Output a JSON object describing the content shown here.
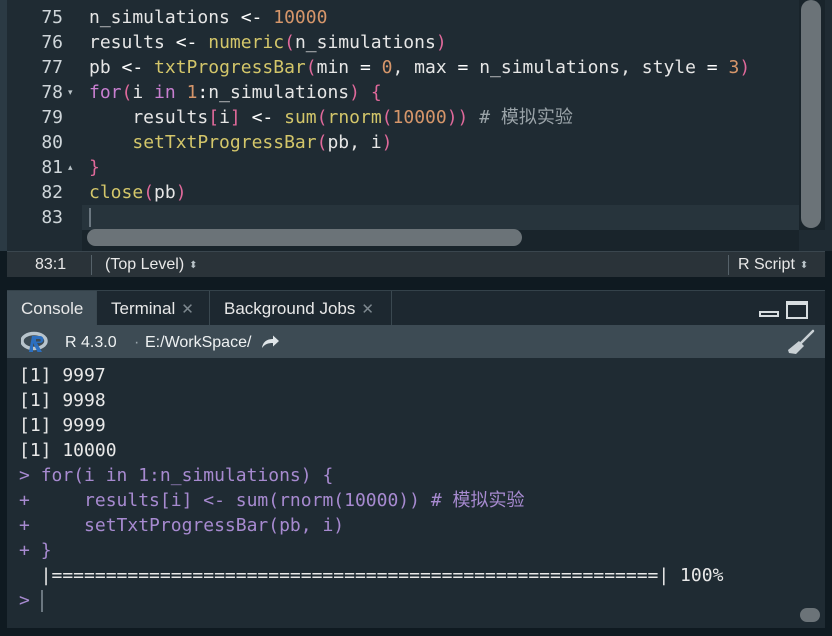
{
  "editor": {
    "lines": [
      {
        "num": "75",
        "fold": "",
        "tokens": [
          {
            "t": "n_simulations ",
            "c": ""
          },
          {
            "t": "<-",
            "c": "op"
          },
          {
            "t": " ",
            "c": ""
          },
          {
            "t": "10000",
            "c": "num"
          }
        ]
      },
      {
        "num": "76",
        "fold": "",
        "tokens": [
          {
            "t": "results ",
            "c": ""
          },
          {
            "t": "<-",
            "c": "op"
          },
          {
            "t": " ",
            "c": ""
          },
          {
            "t": "numeric",
            "c": "fn"
          },
          {
            "t": "(",
            "c": "pa"
          },
          {
            "t": "n_simulations",
            "c": ""
          },
          {
            "t": ")",
            "c": "pa"
          }
        ]
      },
      {
        "num": "77",
        "fold": "",
        "tokens": [
          {
            "t": "pb ",
            "c": ""
          },
          {
            "t": "<-",
            "c": "op"
          },
          {
            "t": " ",
            "c": ""
          },
          {
            "t": "txtProgressBar",
            "c": "fn"
          },
          {
            "t": "(",
            "c": "pa"
          },
          {
            "t": "min ",
            "c": ""
          },
          {
            "t": "=",
            "c": "op"
          },
          {
            "t": " ",
            "c": ""
          },
          {
            "t": "0",
            "c": "num"
          },
          {
            "t": ", max ",
            "c": ""
          },
          {
            "t": "=",
            "c": "op"
          },
          {
            "t": " n_simulations, style ",
            "c": ""
          },
          {
            "t": "=",
            "c": "op"
          },
          {
            "t": " ",
            "c": ""
          },
          {
            "t": "3",
            "c": "num"
          },
          {
            "t": ")",
            "c": "pa"
          }
        ]
      },
      {
        "num": "78",
        "fold": "▾",
        "tokens": [
          {
            "t": "for",
            "c": "kw"
          },
          {
            "t": "(",
            "c": "pa"
          },
          {
            "t": "i ",
            "c": ""
          },
          {
            "t": "in",
            "c": "kw"
          },
          {
            "t": " ",
            "c": ""
          },
          {
            "t": "1",
            "c": "num"
          },
          {
            "t": ":",
            "c": "op"
          },
          {
            "t": "n_simulations",
            "c": ""
          },
          {
            "t": ")",
            "c": "pa"
          },
          {
            "t": " ",
            "c": ""
          },
          {
            "t": "{",
            "c": "pa"
          }
        ]
      },
      {
        "num": "79",
        "fold": "",
        "tokens": [
          {
            "t": "    results",
            "c": ""
          },
          {
            "t": "[",
            "c": "pa"
          },
          {
            "t": "i",
            "c": ""
          },
          {
            "t": "]",
            "c": "pa"
          },
          {
            "t": " ",
            "c": ""
          },
          {
            "t": "<-",
            "c": "op"
          },
          {
            "t": " ",
            "c": ""
          },
          {
            "t": "sum",
            "c": "fn"
          },
          {
            "t": "(",
            "c": "pa"
          },
          {
            "t": "rnorm",
            "c": "fn"
          },
          {
            "t": "(",
            "c": "pa"
          },
          {
            "t": "10000",
            "c": "num"
          },
          {
            "t": "))",
            "c": "pa"
          },
          {
            "t": " # 模拟实验",
            "c": "cm"
          }
        ]
      },
      {
        "num": "80",
        "fold": "",
        "tokens": [
          {
            "t": "    ",
            "c": ""
          },
          {
            "t": "setTxtProgressBar",
            "c": "fn"
          },
          {
            "t": "(",
            "c": "pa"
          },
          {
            "t": "pb, i",
            "c": ""
          },
          {
            "t": ")",
            "c": "pa"
          }
        ]
      },
      {
        "num": "81",
        "fold": "▴",
        "tokens": [
          {
            "t": "}",
            "c": "pa"
          }
        ]
      },
      {
        "num": "82",
        "fold": "",
        "tokens": [
          {
            "t": "close",
            "c": "fn"
          },
          {
            "t": "(",
            "c": "pa"
          },
          {
            "t": "pb",
            "c": ""
          },
          {
            "t": ")",
            "c": "pa"
          }
        ]
      },
      {
        "num": "83",
        "fold": "",
        "tokens": []
      }
    ]
  },
  "statusbar": {
    "position": "83:1",
    "scope": "(Top Level)",
    "file_type": "R Script"
  },
  "tabs": [
    {
      "label": "Console",
      "closable": false
    },
    {
      "label": "Terminal",
      "closable": true
    },
    {
      "label": "Background Jobs",
      "closable": true
    }
  ],
  "console_header": {
    "r_version": "R 4.3.0",
    "separator": "·",
    "working_dir": "E:/WorkSpace/"
  },
  "console": {
    "lines": [
      {
        "text": "[1] 9997",
        "kind": "out"
      },
      {
        "text": "[1] 9998",
        "kind": "out"
      },
      {
        "text": "[1] 9999",
        "kind": "out"
      },
      {
        "text": "[1] 10000",
        "kind": "out"
      },
      {
        "prompt": ">",
        "text": "for(i in 1:n_simulations) {",
        "kind": "in"
      },
      {
        "prompt": "+",
        "text": "    results[i] <- sum(rnorm(10000)) # 模拟实验",
        "kind": "in"
      },
      {
        "prompt": "+",
        "text": "    setTxtProgressBar(pb, i)",
        "kind": "in"
      },
      {
        "prompt": "+",
        "text": "}",
        "kind": "in"
      },
      {
        "text": "  |========================================================| 100%",
        "kind": "out"
      },
      {
        "prompt": ">",
        "text": "",
        "kind": "in"
      }
    ],
    "progress_fraction": 1.0
  },
  "colors": {
    "editor_bg": "#1f2b33",
    "keyword": "#c87fd0",
    "function": "#d3c66a",
    "number": "#d6966a",
    "paren": "#e0699b",
    "comment": "#9aa3a8",
    "console_input": "#a78ad0"
  },
  "icons": {
    "r_logo": "r-logo-icon",
    "goto_dir": "arrow-forward-icon",
    "clear_console": "broom-icon",
    "minimize": "minimize-icon",
    "maximize": "maximize-icon"
  }
}
